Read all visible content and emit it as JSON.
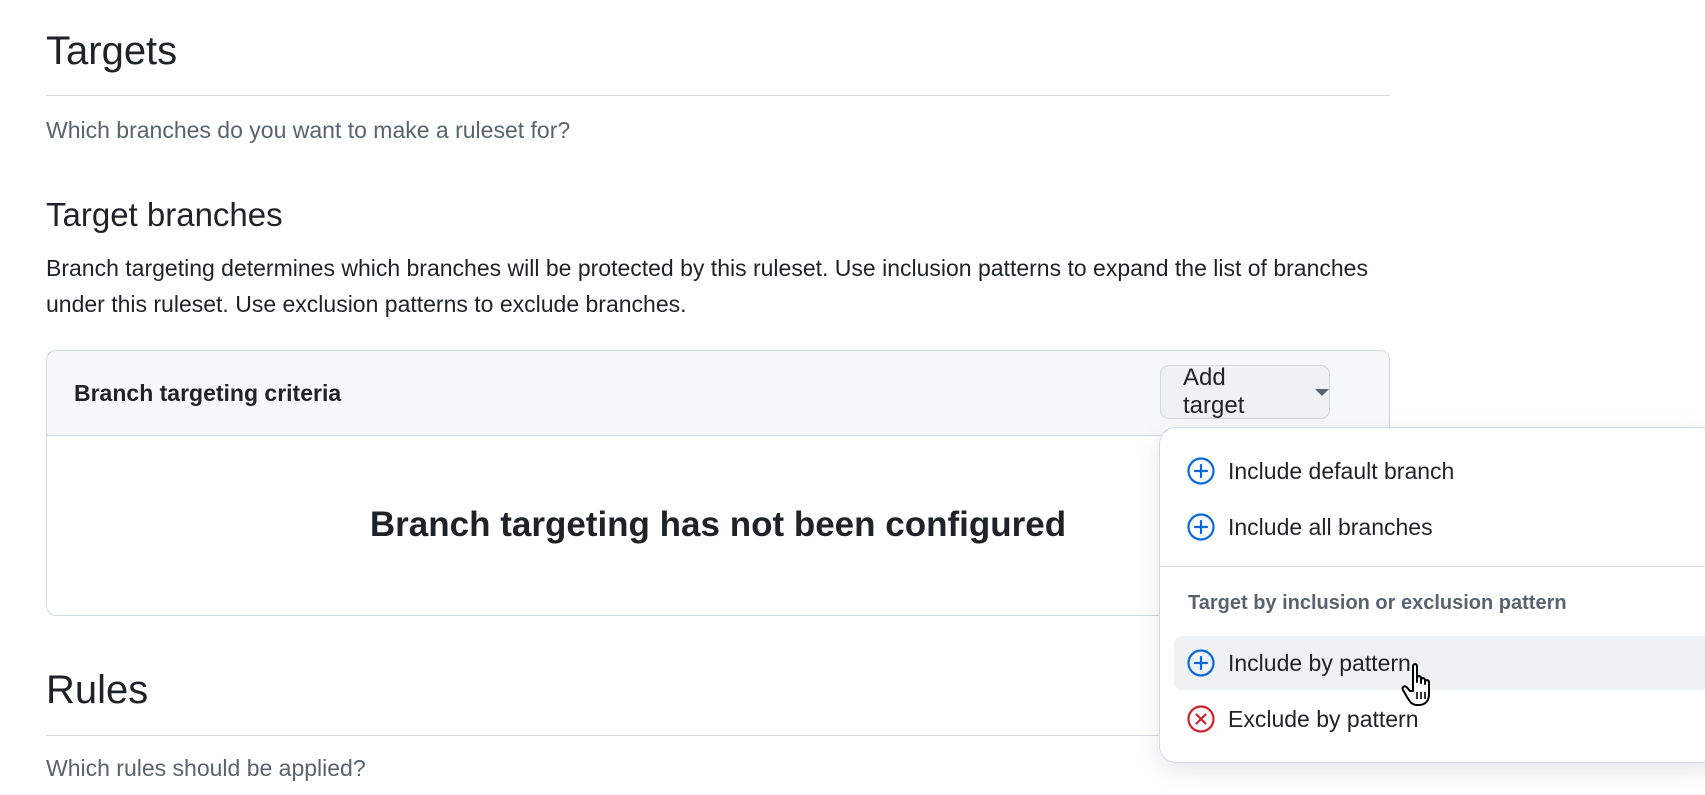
{
  "targets": {
    "title": "Targets",
    "description": "Which branches do you want to make a ruleset for?"
  },
  "target_branches": {
    "title": "Target branches",
    "description": "Branch targeting determines which branches will be protected by this ruleset. Use inclusion patterns to expand the list of branches under this ruleset. Use exclusion patterns to exclude branches."
  },
  "criteria": {
    "title": "Branch targeting criteria",
    "add_target_label": "Add target",
    "empty_message": "Branch targeting has not been configured"
  },
  "dropdown": {
    "items": [
      {
        "label": "Include default branch",
        "icon": "plus-circle-icon"
      },
      {
        "label": "Include all branches",
        "icon": "plus-circle-icon"
      }
    ],
    "group_heading": "Target by inclusion or exclusion pattern",
    "pattern_items": [
      {
        "label": "Include by pattern",
        "icon": "plus-circle-icon",
        "highlighted": true
      },
      {
        "label": "Exclude by pattern",
        "icon": "x-circle-icon",
        "highlighted": false
      }
    ]
  },
  "rules": {
    "title": "Rules",
    "description": "Which rules should be applied?"
  },
  "colors": {
    "include_icon": "#0969da",
    "exclude_icon": "#cf222e",
    "text_primary": "#1f2328",
    "text_muted": "#59636e"
  }
}
